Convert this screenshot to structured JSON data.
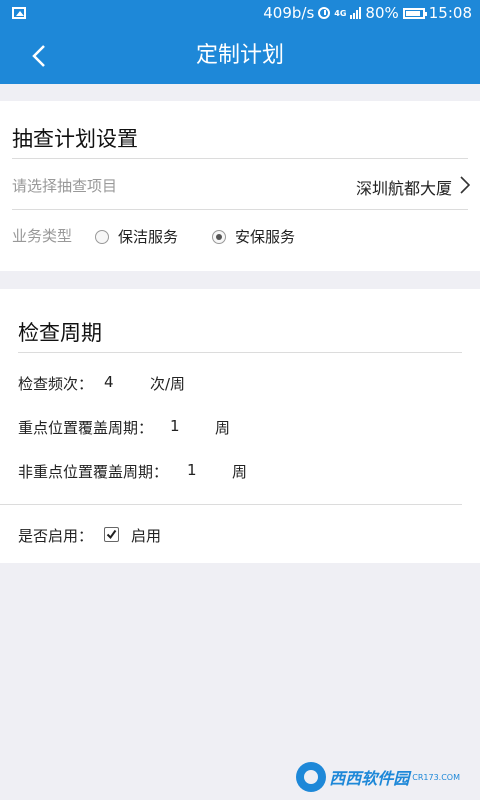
{
  "status_bar": {
    "speed": "409b/s",
    "network": "4G",
    "battery": "80%",
    "time": "15:08"
  },
  "header": {
    "title": "定制计划"
  },
  "plan_settings": {
    "title": "抽查计划设置",
    "project_label": "请选择抽查项目",
    "project_value": "深圳航都大厦",
    "business_type_label": "业务类型",
    "options": [
      {
        "label": "保洁服务",
        "selected": false
      },
      {
        "label": "安保服务",
        "selected": true
      }
    ]
  },
  "cycle": {
    "title": "检查周期",
    "frequency": {
      "label": "检查频次：",
      "value": "4",
      "unit": "次/周"
    },
    "key_coverage": {
      "label": "重点位置覆盖周期：",
      "value": "1",
      "unit": "周"
    },
    "nonkey_coverage": {
      "label": "非重点位置覆盖周期：",
      "value": "1",
      "unit": "周"
    },
    "enable": {
      "label": "是否启用：",
      "option": "启用",
      "checked": true
    }
  },
  "watermark": {
    "brand": "西西软件园",
    "site": "CR173.COM"
  }
}
